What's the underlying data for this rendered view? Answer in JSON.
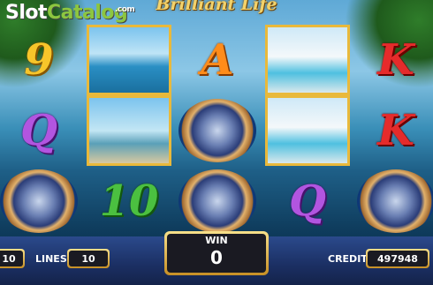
{
  "watermark": {
    "part1": "Slot",
    "part2": "Catalog",
    "part3": ".com"
  },
  "game_title": "Brilliant Life",
  "reels": [
    {
      "symbols": [
        "9",
        "Q",
        "watch"
      ]
    },
    {
      "symbols": [
        "yacht",
        "car",
        "10"
      ]
    },
    {
      "symbols": [
        "A",
        "watch",
        "watch"
      ]
    },
    {
      "symbols": [
        "villa",
        "villa",
        "Q"
      ]
    },
    {
      "symbols": [
        "K",
        "K",
        "watch"
      ]
    }
  ],
  "controls": {
    "bet_value": "10",
    "lines_label": "LINES",
    "lines_value": "10",
    "win_label": "WIN",
    "win_value": "0",
    "credit_label": "CREDIT",
    "credit_value": "497948"
  }
}
